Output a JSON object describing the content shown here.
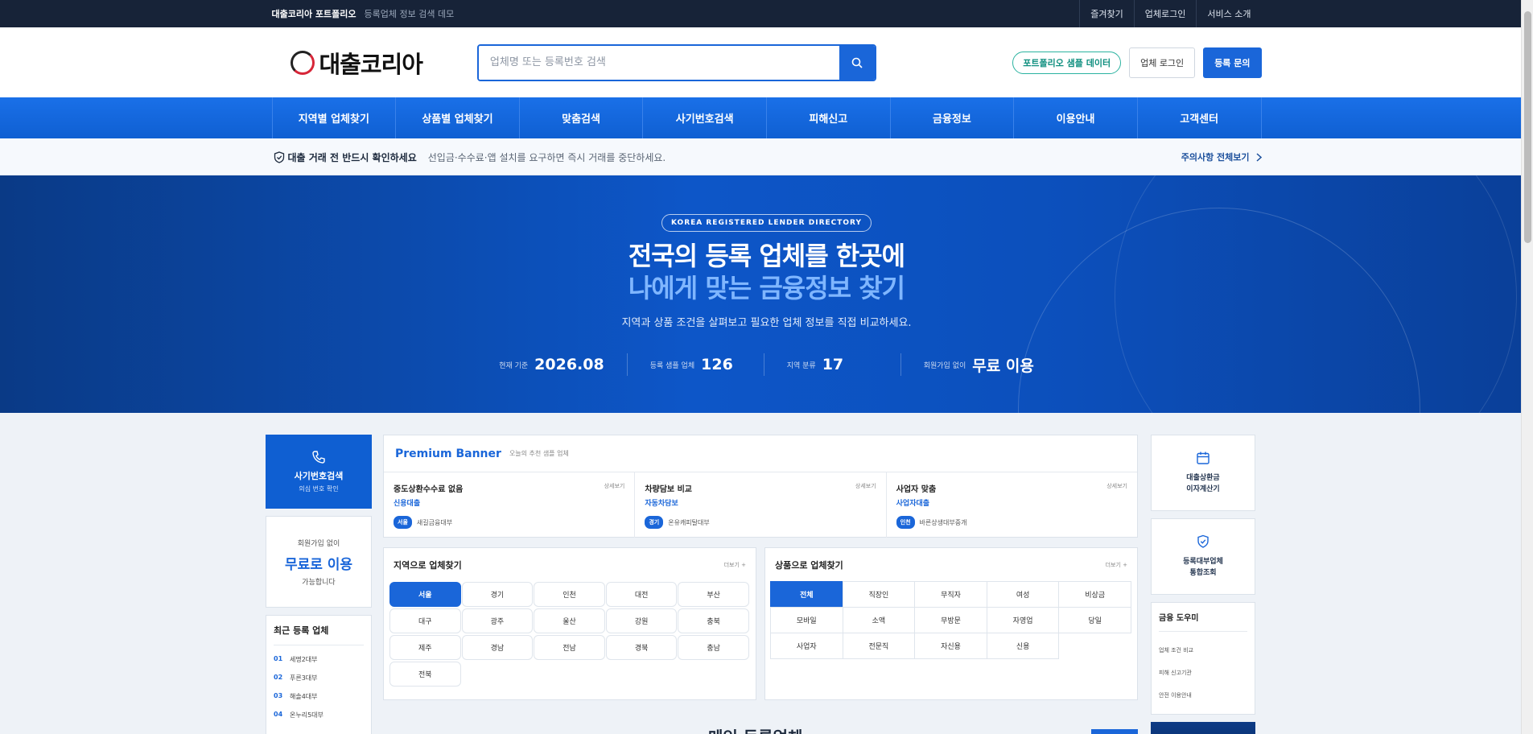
{
  "topbar": {
    "brand": "대출코리아 포트폴리오",
    "sub": "등록업체 정보 검색 데모",
    "links": [
      "즐겨찾기",
      "업체로그인",
      "서비스 소개"
    ]
  },
  "header": {
    "logo": "대출코리아",
    "search_placeholder": "업체명 또는 등록번호 검색",
    "sample_btn": "포트폴리오 샘플 데이터",
    "login_btn": "업체 로그인",
    "register_btn": "등록 문의"
  },
  "nav": [
    "지역별 업체찾기",
    "상품별 업체찾기",
    "맞춤검색",
    "사기번호검색",
    "피해신고",
    "금융정보",
    "이용안내",
    "고객센터"
  ],
  "notice": {
    "title": "대출 거래 전 반드시 확인하세요",
    "text": "선입금·수수료·앱 설치를 요구하면 즉시 거래를 중단하세요.",
    "more": "주의사항 전체보기"
  },
  "hero": {
    "tag": "KOREA REGISTERED LENDER DIRECTORY",
    "line1": "전국의 등록 업체를 한곳에",
    "line2": "나에게 맞는 금융정보 찾기",
    "desc": "지역과 상품 조건을 살펴보고 필요한 업체 정보를 직접 비교하세요.",
    "stats": [
      {
        "label": "현재 기준",
        "value": "2026.08"
      },
      {
        "label": "등록 샘플 업체",
        "value": "126"
      },
      {
        "label": "지역 분류",
        "value": "17"
      },
      {
        "label": "회원가입 없이",
        "value": "무료 이용"
      }
    ]
  },
  "left": {
    "fraud_title": "사기번호검색",
    "fraud_sub": "의심 번호 확인",
    "free_a": "회원가입 없이",
    "free_b": "무료로 이용",
    "free_c": "가능합니다",
    "recent_title": "최근 등록 업체",
    "recent": [
      {
        "no": "01",
        "name": "세명2대부"
      },
      {
        "no": "02",
        "name": "푸른3대부"
      },
      {
        "no": "03",
        "name": "해솔4대부"
      },
      {
        "no": "04",
        "name": "온누리5대부"
      }
    ]
  },
  "premium": {
    "title": "Premium Banner",
    "sub": "오늘의 추천 샘플 업체",
    "cards": [
      {
        "name": "중도상환수수료 없음",
        "cat": "신용대출",
        "more": "상세보기",
        "region": "서울",
        "company": "새길금융대부"
      },
      {
        "name": "차량담보 비교",
        "cat": "자동차담보",
        "more": "상세보기",
        "region": "경기",
        "company": "온유캐피탈대부"
      },
      {
        "name": "사업자 맞춤",
        "cat": "사업자대출",
        "more": "상세보기",
        "region": "인천",
        "company": "바른상생대부중개"
      }
    ]
  },
  "region_finder": {
    "title": "지역으로 업체찾기",
    "more": "더보기 +",
    "items": [
      "서울",
      "경기",
      "인천",
      "대전",
      "부산",
      "대구",
      "광주",
      "울산",
      "강원",
      "충북",
      "제주",
      "경남",
      "전남",
      "경북",
      "충남",
      "전북"
    ]
  },
  "product_finder": {
    "title": "상품으로 업체찾기",
    "more": "더보기 +",
    "items": [
      "전체",
      "직장인",
      "무직자",
      "여성",
      "비상금",
      "모바일",
      "소액",
      "무방문",
      "자영업",
      "당일",
      "사업자",
      "전문직",
      "자신용",
      "신용"
    ]
  },
  "right": {
    "tool1": "대출상환금\n이자계산기",
    "tool2": "등록대부업체\n통합조회",
    "fin_title": "금융 도우미",
    "fin_items": [
      "업체 조건 비교",
      "피해 신고기관",
      "안전 이용안내"
    ]
  },
  "bottom_title": "메인 등록업체"
}
